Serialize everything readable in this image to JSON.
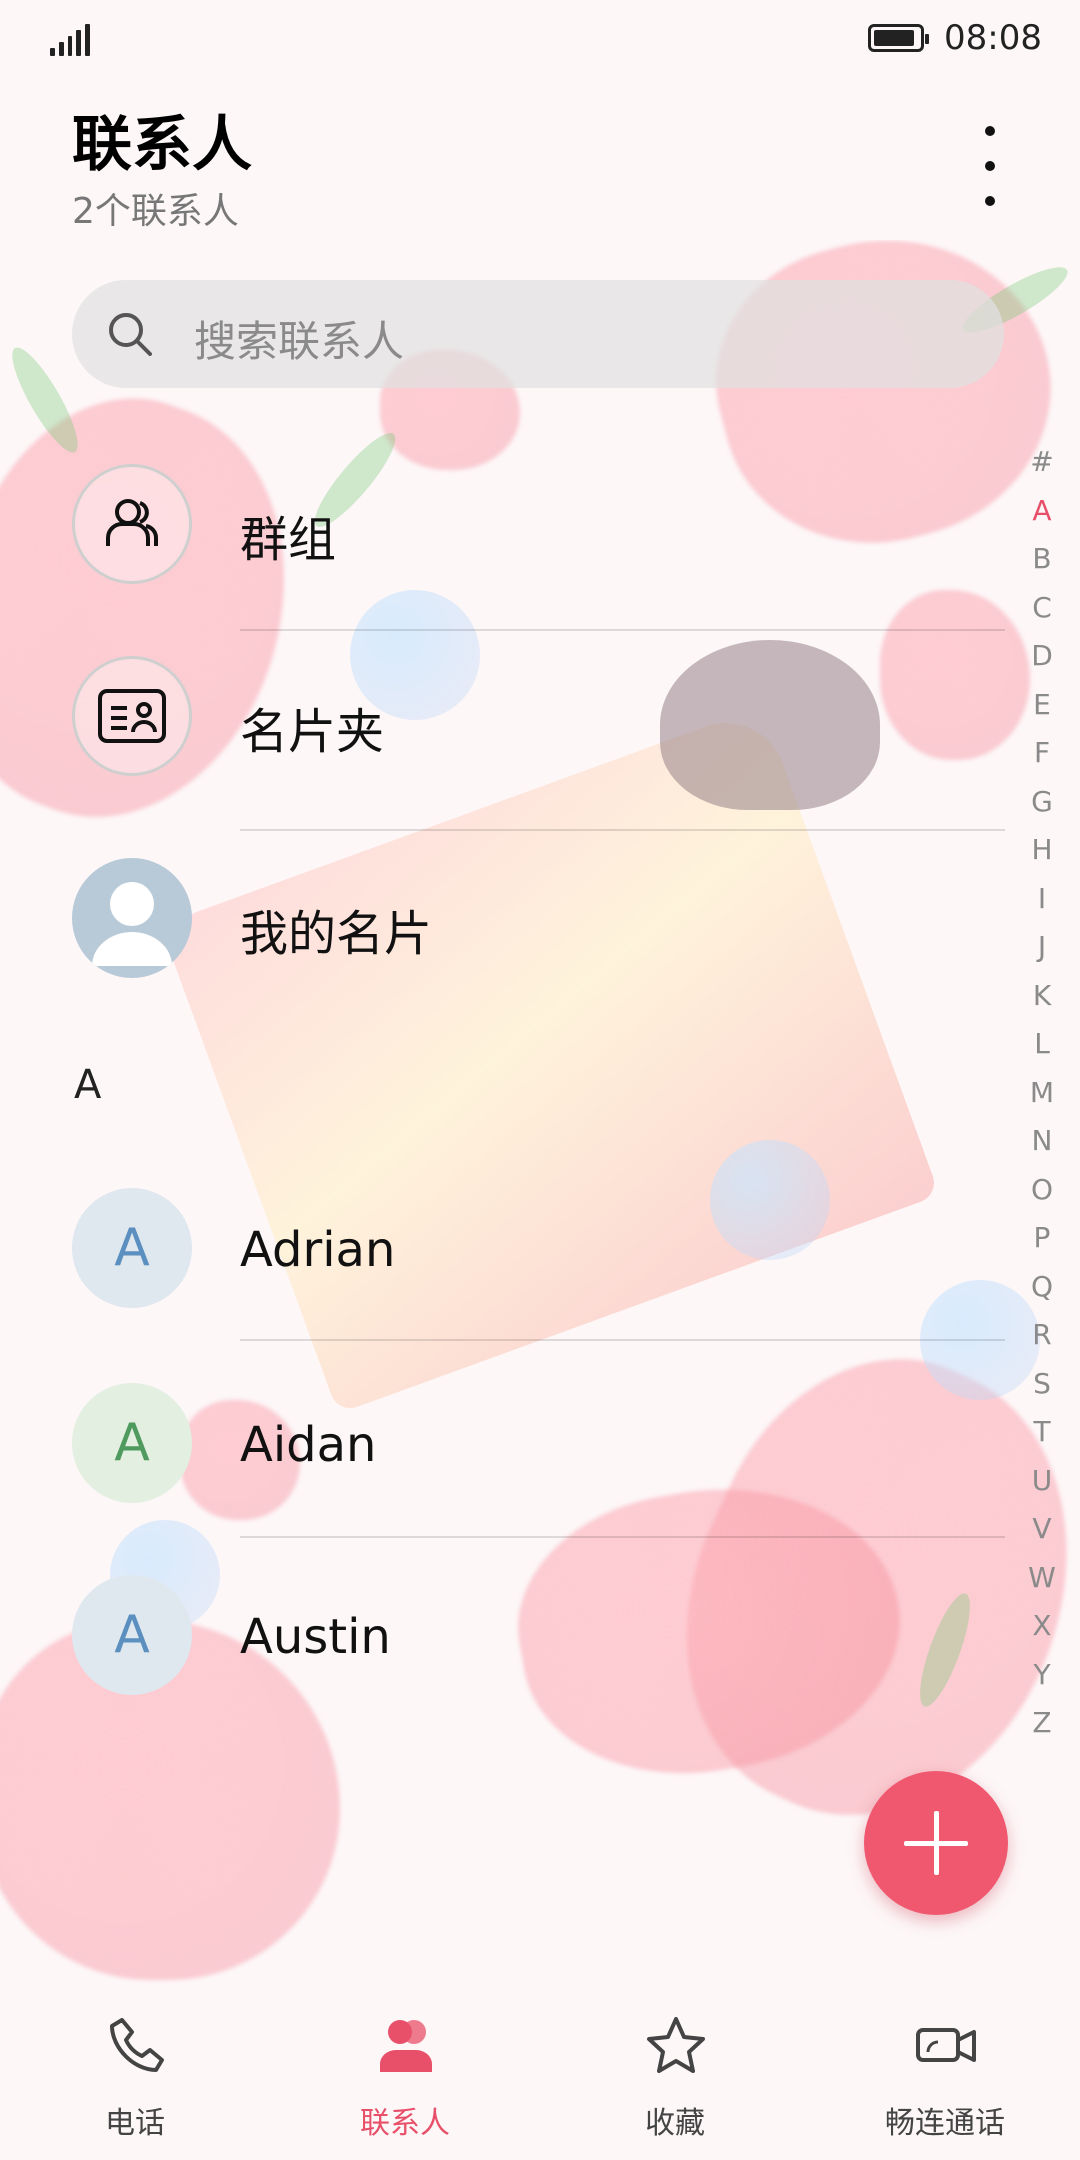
{
  "status_bar": {
    "time": "08:08",
    "battery_level": 0.9
  },
  "header": {
    "title": "联系人",
    "subtitle": "2个联系人"
  },
  "search": {
    "placeholder": "搜索联系人"
  },
  "special_rows": [
    {
      "label": "群组",
      "icon": "group-icon"
    },
    {
      "label": "名片夹",
      "icon": "card-holder-icon"
    },
    {
      "label": "我的名片",
      "icon": "profile-avatar-icon"
    }
  ],
  "section_header": "A",
  "contacts": [
    {
      "initial": "A",
      "name": "Adrian",
      "avatar_bg": "#dfe7ef",
      "avatar_fg": "#5b8fbf"
    },
    {
      "initial": "A",
      "name": "Aidan",
      "avatar_bg": "#e3efe0",
      "avatar_fg": "#4f9a5e"
    },
    {
      "initial": "A",
      "name": "Austin",
      "avatar_bg": "#dfe7ef",
      "avatar_fg": "#5b8fbf"
    }
  ],
  "index_bar": {
    "letters": [
      "#",
      "A",
      "B",
      "C",
      "D",
      "E",
      "F",
      "G",
      "H",
      "I",
      "J",
      "K",
      "L",
      "M",
      "N",
      "O",
      "P",
      "Q",
      "R",
      "S",
      "T",
      "U",
      "V",
      "W",
      "X",
      "Y",
      "Z"
    ],
    "active": "A"
  },
  "bottom_nav": {
    "tabs": [
      {
        "label": "电话",
        "icon": "phone-icon"
      },
      {
        "label": "联系人",
        "icon": "contacts-icon",
        "active": true
      },
      {
        "label": "收藏",
        "icon": "star-icon"
      },
      {
        "label": "畅连通话",
        "icon": "video-call-icon"
      }
    ]
  },
  "colors": {
    "accent": "#e8506a",
    "fab": "#f0586f"
  }
}
